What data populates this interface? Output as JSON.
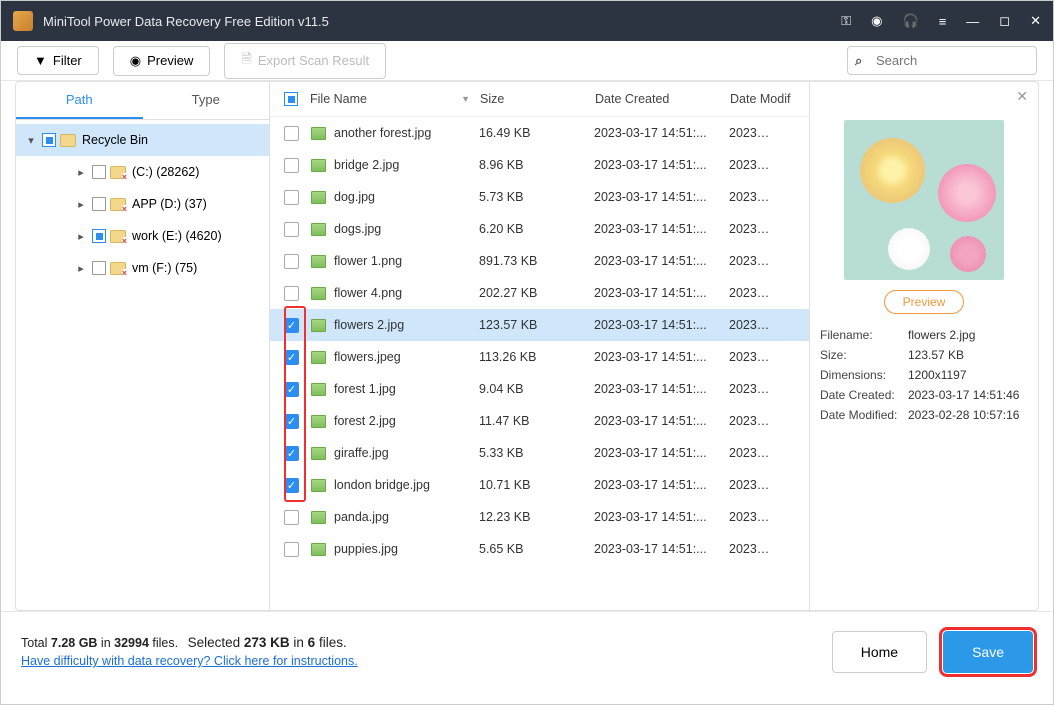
{
  "title": "MiniTool Power Data Recovery Free Edition v11.5",
  "toolbar": {
    "filter": "Filter",
    "preview": "Preview",
    "export": "Export Scan Result",
    "search_placeholder": "Search"
  },
  "tabs": {
    "path": "Path",
    "type": "Type"
  },
  "tree": {
    "root": "Recycle Bin",
    "children": [
      "(C:) (28262)",
      "APP (D:) (37)",
      "work (E:) (4620)",
      "vm (F:) (75)"
    ]
  },
  "columns": {
    "name": "File Name",
    "size": "Size",
    "created": "Date Created",
    "modified": "Date Modif"
  },
  "files": [
    {
      "name": "another forest.jpg",
      "size": "16.49 KB",
      "date": "2023-03-17 14:51:...",
      "mod": "2023…",
      "checked": false
    },
    {
      "name": "bridge 2.jpg",
      "size": "8.96 KB",
      "date": "2023-03-17 14:51:...",
      "mod": "2023…",
      "checked": false
    },
    {
      "name": "dog.jpg",
      "size": "5.73 KB",
      "date": "2023-03-17 14:51:...",
      "mod": "2023…",
      "checked": false
    },
    {
      "name": "dogs.jpg",
      "size": "6.20 KB",
      "date": "2023-03-17 14:51:...",
      "mod": "2023…",
      "checked": false
    },
    {
      "name": "flower 1.png",
      "size": "891.73 KB",
      "date": "2023-03-17 14:51:...",
      "mod": "2023…",
      "checked": false
    },
    {
      "name": "flower 4.png",
      "size": "202.27 KB",
      "date": "2023-03-17 14:51:...",
      "mod": "2023…",
      "checked": false
    },
    {
      "name": "flowers 2.jpg",
      "size": "123.57 KB",
      "date": "2023-03-17 14:51:...",
      "mod": "2023…",
      "checked": true,
      "selected": true
    },
    {
      "name": "flowers.jpeg",
      "size": "113.26 KB",
      "date": "2023-03-17 14:51:...",
      "mod": "2023…",
      "checked": true
    },
    {
      "name": "forest 1.jpg",
      "size": "9.04 KB",
      "date": "2023-03-17 14:51:...",
      "mod": "2023…",
      "checked": true
    },
    {
      "name": "forest 2.jpg",
      "size": "11.47 KB",
      "date": "2023-03-17 14:51:...",
      "mod": "2023…",
      "checked": true
    },
    {
      "name": "giraffe.jpg",
      "size": "5.33 KB",
      "date": "2023-03-17 14:51:...",
      "mod": "2023…",
      "checked": true
    },
    {
      "name": "london bridge.jpg",
      "size": "10.71 KB",
      "date": "2023-03-17 14:51:...",
      "mod": "2023…",
      "checked": true
    },
    {
      "name": "panda.jpg",
      "size": "12.23 KB",
      "date": "2023-03-17 14:51:...",
      "mod": "2023…",
      "checked": false
    },
    {
      "name": "puppies.jpg",
      "size": "5.65 KB",
      "date": "2023-03-17 14:51:...",
      "mod": "2023…",
      "checked": false
    }
  ],
  "preview": {
    "btn": "Preview",
    "filename_lbl": "Filename:",
    "filename": "flowers 2.jpg",
    "size_lbl": "Size:",
    "size": "123.57 KB",
    "dim_lbl": "Dimensions:",
    "dim": "1200x1197",
    "created_lbl": "Date Created:",
    "created": "2023-03-17 14:51:46",
    "modified_lbl": "Date Modified:",
    "modified": "2023-02-28 10:57:16"
  },
  "footer": {
    "total_prefix": "Total ",
    "total_gb": "7.28 GB",
    "total_mid": " in ",
    "total_files": "32994",
    "total_suffix": " files.",
    "sel_prefix": "Selected ",
    "sel_kb": "273 KB",
    "sel_mid": " in ",
    "sel_files": "6",
    "sel_suffix": " files.",
    "help_link": "Have difficulty with data recovery? Click here for instructions.",
    "home": "Home",
    "save": "Save"
  }
}
